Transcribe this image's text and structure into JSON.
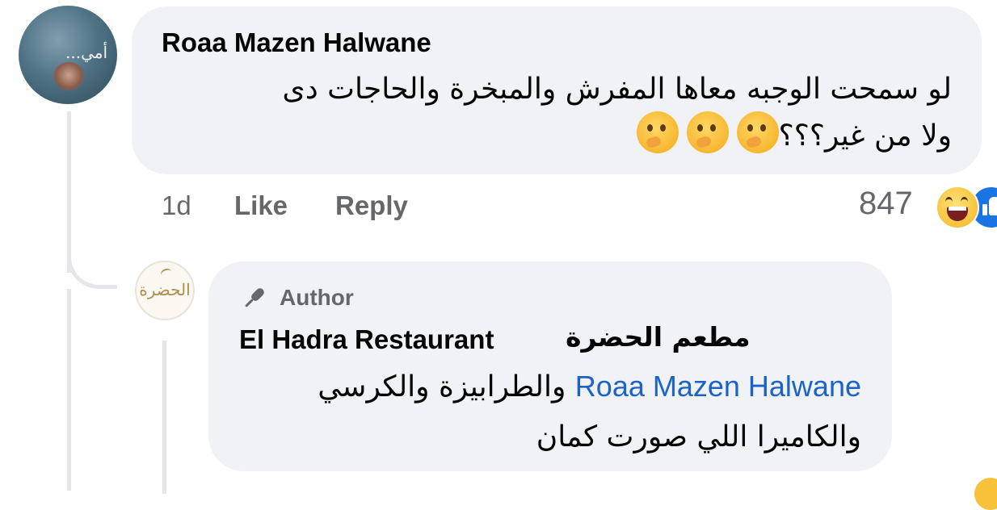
{
  "comment": {
    "author": "Roaa Mazen Halwane",
    "avatar_text": "أمي...",
    "text_line1": "لو سمحت الوجبه معاها المفرش والمبخرة والحاجات دى",
    "text_line2": "ولا من غير؟؟؟",
    "emojis": [
      "thinking-face",
      "thinking-face",
      "thinking-face"
    ],
    "time": "1d",
    "like_label": "Like",
    "reply_label": "Reply",
    "reaction_count": "847",
    "reactions": [
      "laughing-face",
      "like"
    ]
  },
  "reply": {
    "author_badge": "Author",
    "author_name": "El Hadra Restaurant",
    "author_name_ar": "مطعم الحضرة",
    "avatar_text": "الحضرة",
    "mention": "Roaa Mazen Halwane",
    "text_line1_rest": " والطرابيزة والكرسي",
    "text_line2": "والكاميرا اللي صورت كمان"
  },
  "colors": {
    "bubble": "#f0f2f5",
    "meta": "#65676b",
    "mention": "#1b63c9",
    "like_blue": "#1b74e4"
  }
}
